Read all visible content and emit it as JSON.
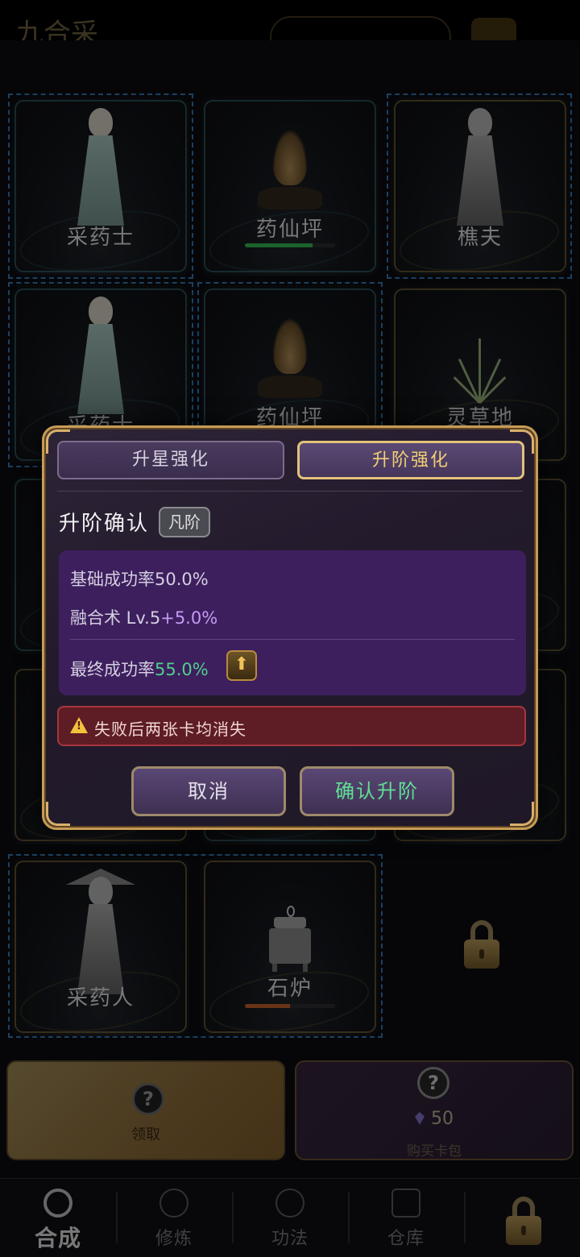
{
  "header": {
    "title": "九合采"
  },
  "board": {
    "cards": [
      {
        "label": "采药士"
      },
      {
        "label": "药仙坪",
        "progress": 0.75,
        "bar_color": "#2faa4d"
      },
      {
        "label": "樵夫"
      },
      {
        "label": "采药士"
      },
      {
        "label": "药仙坪"
      },
      {
        "label": "灵草地"
      },
      {
        "label": "采药人"
      },
      {
        "label": "石炉",
        "progress": 0.5,
        "bar_color": "#b35a27"
      }
    ]
  },
  "dialog": {
    "tabs": [
      {
        "label": "升星强化",
        "active": false
      },
      {
        "label": "升阶强化",
        "active": true
      }
    ],
    "title": "升阶确认",
    "rank_badge": "凡阶",
    "base_rate": "基础成功率50.0%",
    "skill_label": "融合术 Lv.5",
    "skill_bonus": "+5.0%",
    "final_label": "最终成功率",
    "final_rate": "55.0%",
    "warning": "失败后两张卡均消失",
    "cancel": "取消",
    "confirm": "确认升阶"
  },
  "actions": {
    "claim": "领取",
    "buy_price": "50",
    "buy_label": "购买卡包"
  },
  "nav": {
    "items": [
      "合成",
      "修炼",
      "功法",
      "仓库"
    ],
    "active_index": 0
  },
  "colors": {
    "accent_gold": "#f3cf72",
    "success_green": "#4fd08c",
    "bonus_purple": "#c59af3",
    "warning_red": "#5e1c24"
  }
}
